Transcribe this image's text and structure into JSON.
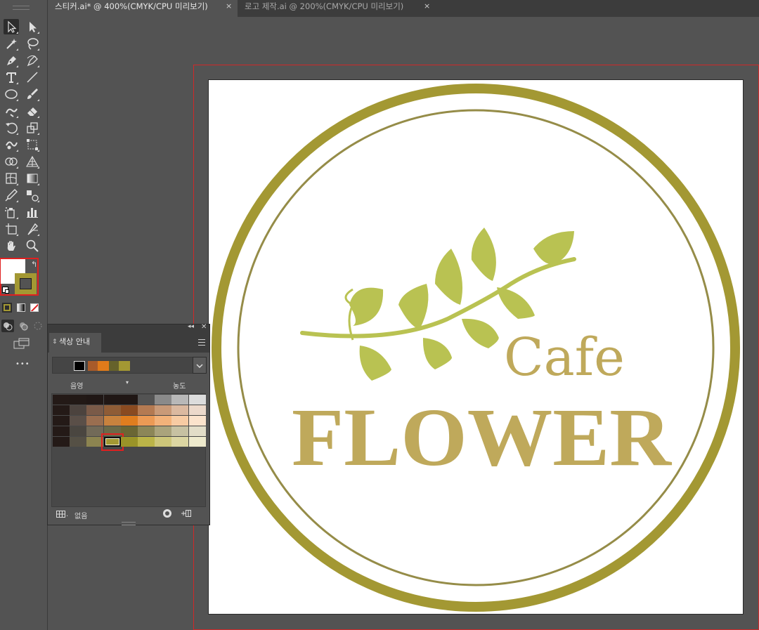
{
  "tabs": [
    {
      "label": "스티커.ai* @ 400%(CMYK/CPU 미리보기)",
      "close": "×",
      "active": true
    },
    {
      "label": "로고 제작.ai @ 200%(CMYK/CPU 미리보기)",
      "close": "×",
      "active": false
    }
  ],
  "toolbar": {
    "tools": [
      "selection-tool",
      "direct-selection-tool",
      "magic-wand-tool",
      "lasso-tool",
      "pen-tool",
      "curvature-tool",
      "type-tool",
      "line-segment-tool",
      "ellipse-tool",
      "paintbrush-tool",
      "shaper-tool",
      "eraser-tool",
      "rotate-tool",
      "scale-tool",
      "warp-tool",
      "free-transform-tool",
      "shape-builder-tool",
      "perspective-grid-tool",
      "mesh-tool",
      "gradient-tool",
      "eyedropper-tool",
      "blend-tool",
      "symbol-sprayer-tool",
      "column-graph-tool",
      "artboard-tool",
      "slice-tool",
      "hand-tool",
      "zoom-tool"
    ],
    "fill_color": "#ffffff",
    "stroke_color": "#a39833",
    "more_label": "•••"
  },
  "panel": {
    "title": "색상 안내",
    "shade_label": "음영",
    "tint_label": "농도",
    "none_label": "없음",
    "base_color": "#a39833",
    "harmony_colors": [
      "#000000",
      "#a85b2a",
      "#e07b1a",
      "#66622b",
      "#a39833"
    ],
    "grid_colors": [
      [
        "#241a17",
        "#221916",
        "#201715",
        "#201715",
        "#201715",
        "#535353",
        "#8a8a8a",
        "#b8b8b8",
        "#dcdcdc"
      ],
      [
        "#241a17",
        "#4c433e",
        "#7a5a48",
        "#8f5c36",
        "#8a4a20",
        "#b47a52",
        "#c99a78",
        "#dbb9a0",
        "#ecd9cb"
      ],
      [
        "#241a17",
        "#5a4f48",
        "#9a6e50",
        "#c8823e",
        "#df7d1f",
        "#eb9a55",
        "#f2b27a",
        "#f7cba3",
        "#fbe3cc"
      ],
      [
        "#241a17",
        "#4a4640",
        "#726a58",
        "#6b6a48",
        "#6a6634",
        "#8c8658",
        "#aaa37c",
        "#c7c1a2",
        "#e2ddc8"
      ],
      [
        "#241a17",
        "#555045",
        "#8c8450",
        "#a39833",
        "#9a9428",
        "#bbb448",
        "#cdc67a",
        "#dcd6a2",
        "#eeeacd"
      ]
    ],
    "selected_cell": [
      4,
      3
    ]
  },
  "artwork": {
    "small_word": "Cafe",
    "big_word": "FLOWER",
    "ring_color": "#a39833",
    "text_color": "#bfa95b",
    "leaf_color": "#b9c252"
  }
}
